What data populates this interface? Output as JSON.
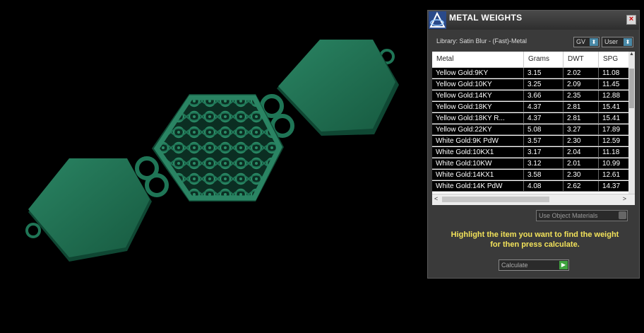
{
  "panel": {
    "title": "METAL WEIGHTS",
    "close_label": "×",
    "library_label": "Library: Satin Blur - (Fast)-Metal",
    "gv_label": "GV",
    "user_label": "User",
    "combo_arrow": "⬍"
  },
  "table": {
    "headers": [
      "Metal",
      "Grams",
      "DWT",
      "SPG"
    ],
    "rows": [
      [
        "Yellow Gold:9KY",
        "3.15",
        "2.02",
        "11.08"
      ],
      [
        "Yellow Gold:10KY",
        "3.25",
        "2.09",
        "11.45"
      ],
      [
        "Yellow Gold:14KY",
        "3.66",
        "2.35",
        "12.88"
      ],
      [
        "Yellow Gold:18KY",
        "4.37",
        "2.81",
        "15.41"
      ],
      [
        "Yellow Gold:18KY R...",
        "4.37",
        "2.81",
        "15.41"
      ],
      [
        "Yellow Gold:22KY",
        "5.08",
        "3.27",
        "17.89"
      ],
      [
        "White Gold:9K PdW",
        "3.57",
        "2.30",
        "12.59"
      ],
      [
        "White Gold:10KX1",
        "3.17",
        "2.04",
        "11.18"
      ],
      [
        "White Gold:10KW",
        "3.12",
        "2.01",
        "10.99"
      ],
      [
        "White Gold:14KX1",
        "3.58",
        "2.30",
        "12.61"
      ],
      [
        "White Gold:14K PdW",
        "4.08",
        "2.62",
        "14.37"
      ]
    ]
  },
  "controls": {
    "use_object_materials": "Use Object Materials",
    "hint_line1": "Highlight the item you want to find the weight",
    "hint_line2": "for then press calculate.",
    "calculate_label": "Calculate",
    "calculate_arrow": "▶"
  },
  "colors": {
    "model_green": "#1d6b4f",
    "hint_yellow": "#f2e25a"
  }
}
